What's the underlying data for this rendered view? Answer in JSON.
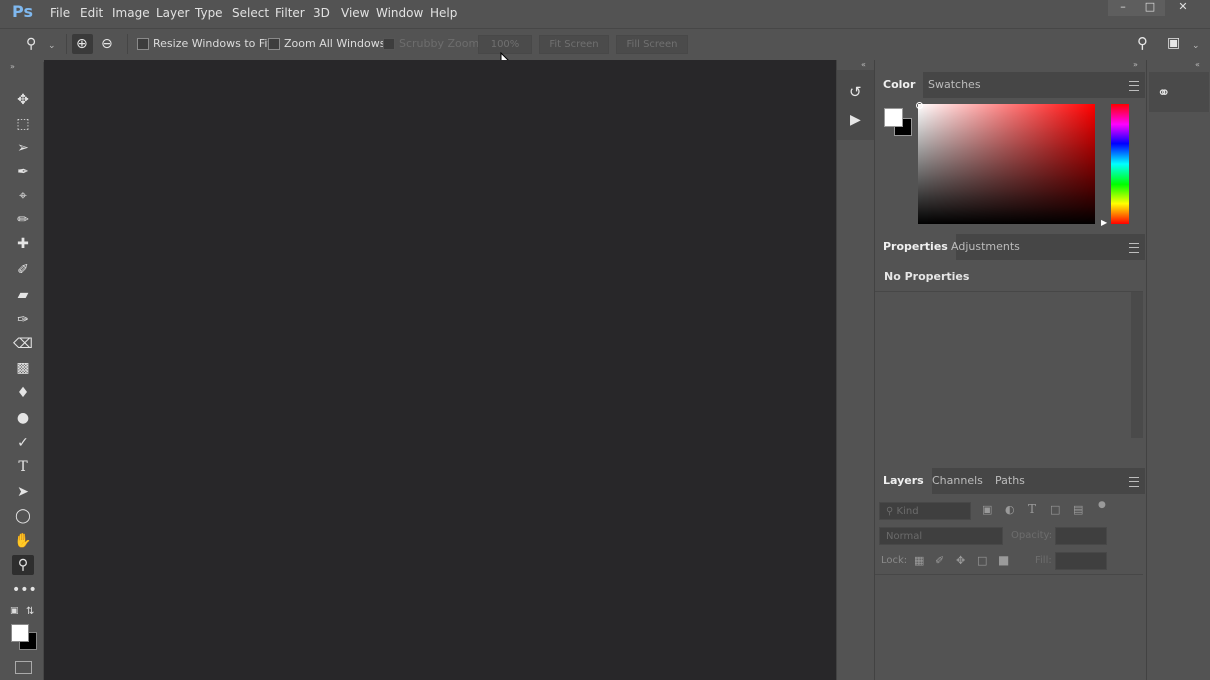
{
  "app": {
    "logo": "Ps"
  },
  "menu": [
    "File",
    "Edit",
    "Image",
    "Layer",
    "Type",
    "Select",
    "Filter",
    "3D",
    "View",
    "Window",
    "Help"
  ],
  "options": {
    "resize_windows": "Resize Windows to Fit",
    "zoom_all": "Zoom All Windows",
    "scrubby": "Scrubby Zoom",
    "zoom_level": "100%",
    "fit_screen": "Fit Screen",
    "fill_screen": "Fill Screen"
  },
  "color_panel": {
    "tabs": [
      "Color",
      "Swatches"
    ]
  },
  "properties_panel": {
    "tabs": [
      "Properties",
      "Adjustments"
    ],
    "empty_text": "No Properties"
  },
  "layers_panel": {
    "tabs": [
      "Layers",
      "Channels",
      "Paths"
    ],
    "kind_placeholder": "Kind",
    "blend_mode": "Normal",
    "opacity_label": "Opacity:",
    "lock_label": "Lock:",
    "fill_label": "Fill:"
  },
  "colors": {
    "accent": "#7fb8ef",
    "canvas": "#282729",
    "panel": "#535353"
  }
}
